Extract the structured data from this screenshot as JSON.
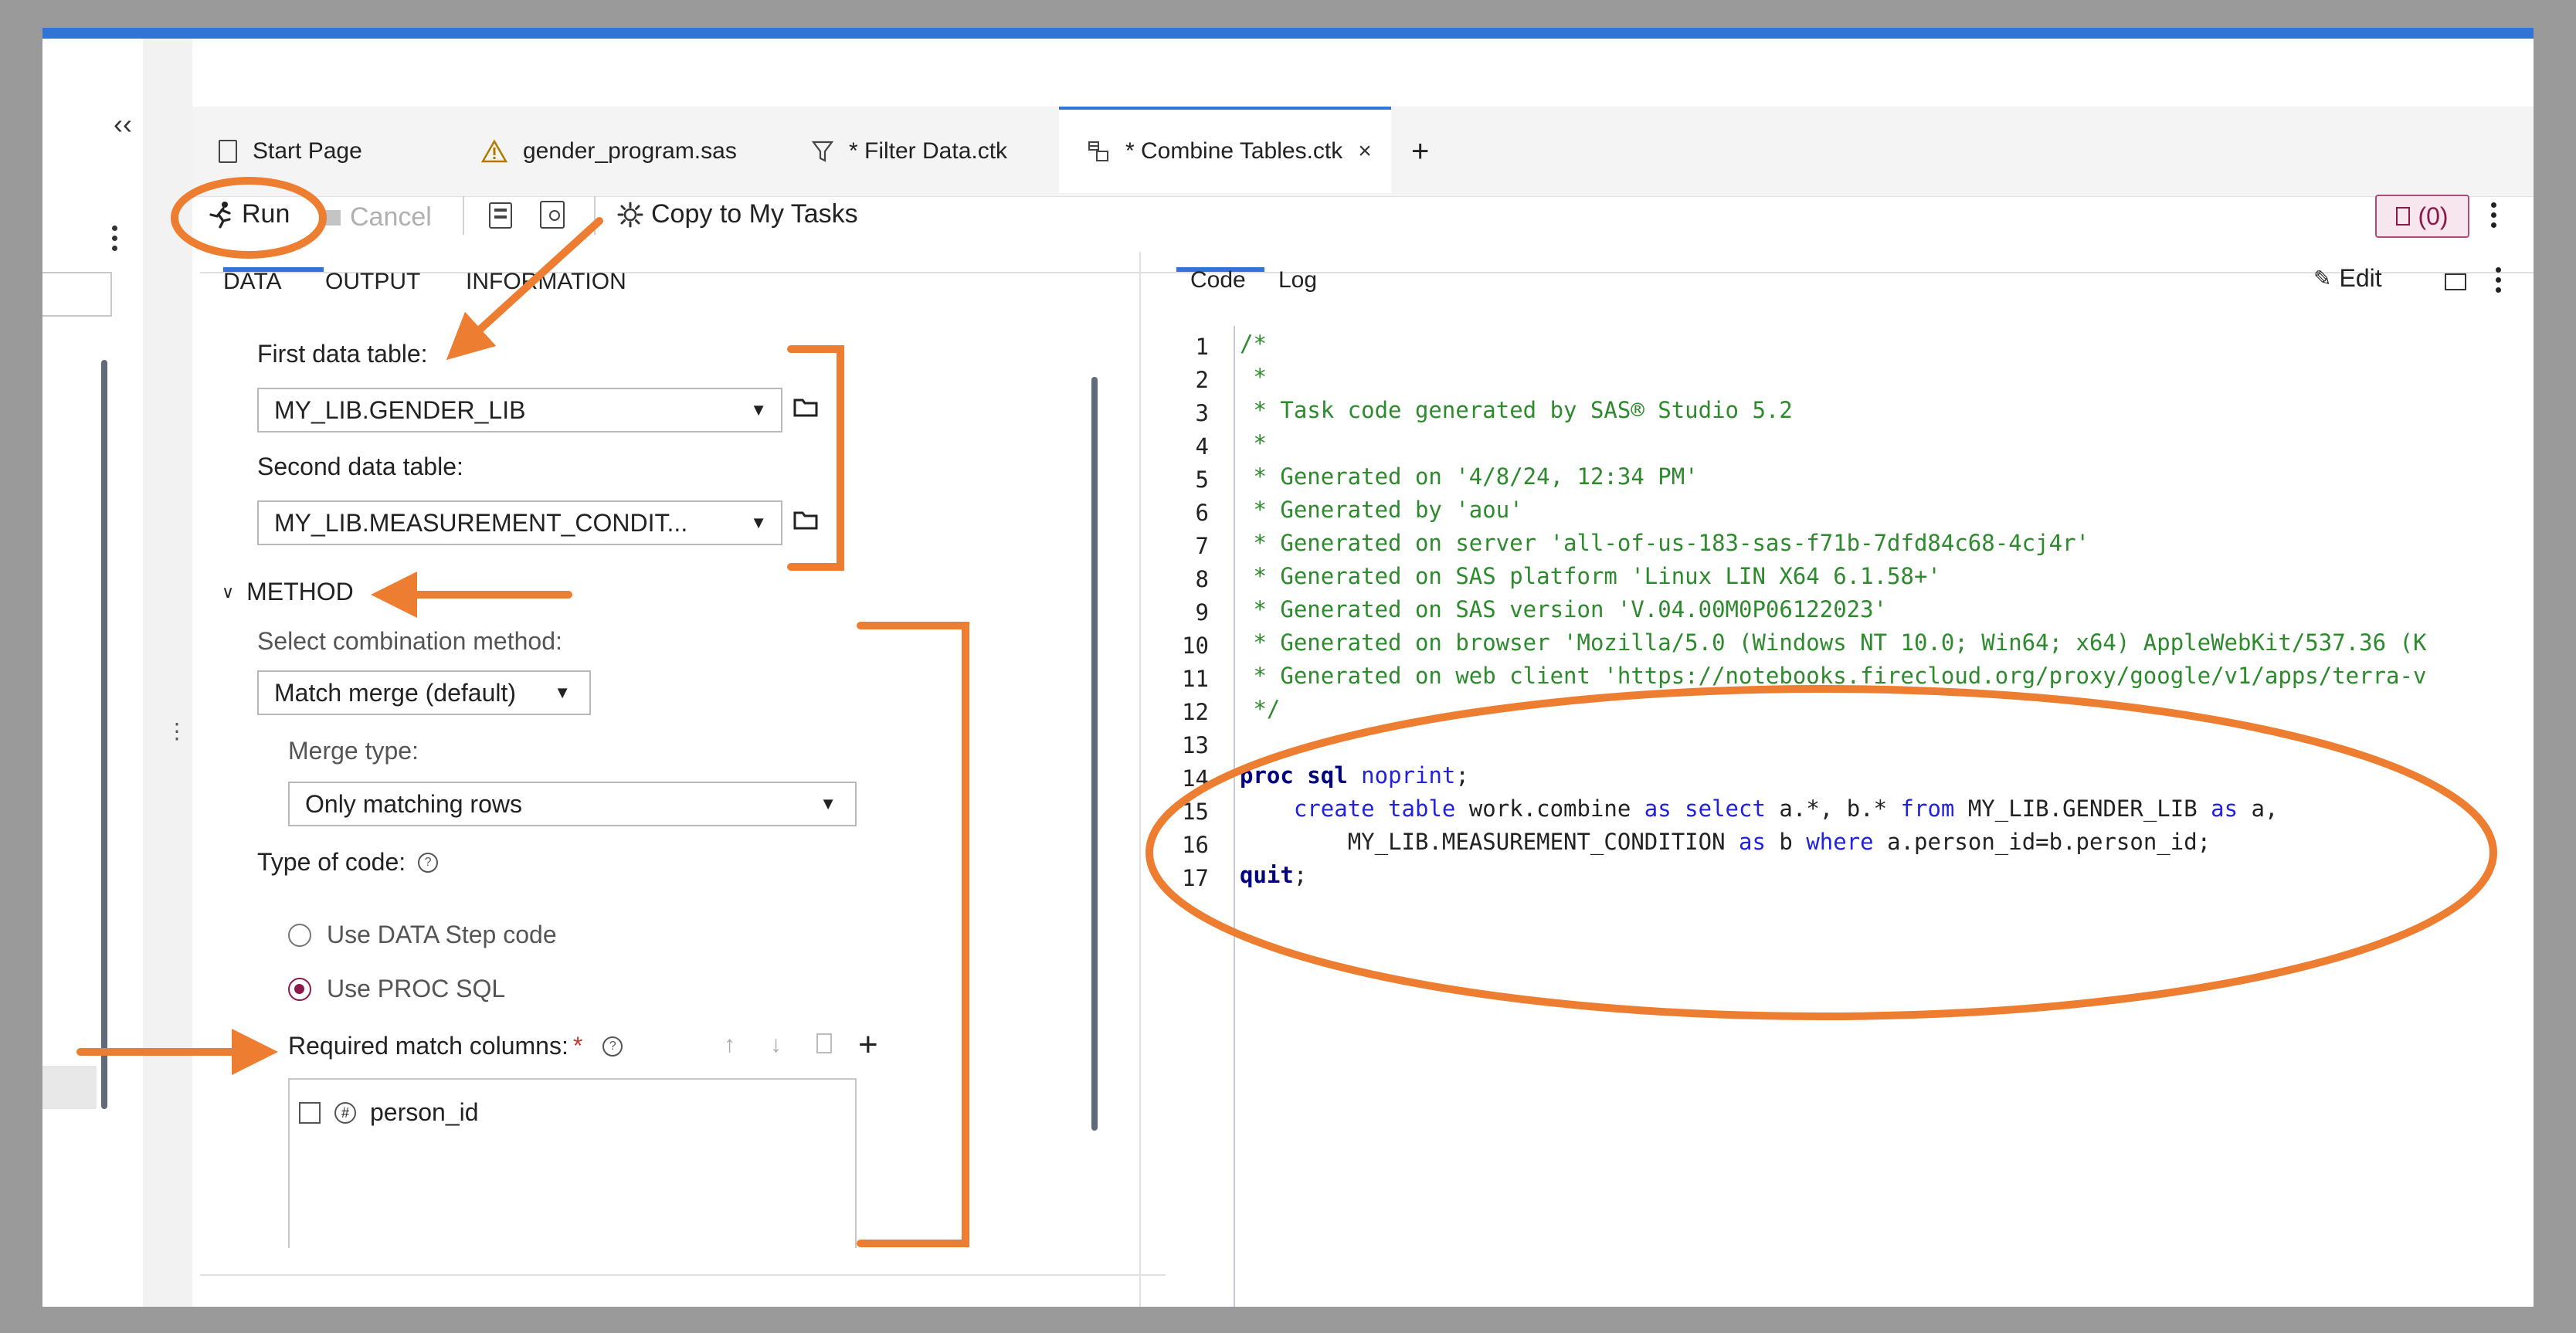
{
  "tabs": [
    {
      "label": "Start Page",
      "icon": "start-page-icon"
    },
    {
      "label": "gender_program.sas",
      "icon": "warning-icon"
    },
    {
      "label": "* Filter Data.ctk",
      "icon": "filter-icon"
    },
    {
      "label": "* Combine Tables.ctk",
      "icon": "task-icon",
      "active": true
    }
  ],
  "tab_close": "×",
  "tab_add": "+",
  "collapse": "‹‹",
  "toolbar": {
    "run": "Run",
    "cancel": "Cancel",
    "copy_to_tasks": "Copy to My Tasks",
    "submissions": "(0)"
  },
  "left_tabs": [
    "DATA",
    "OUTPUT",
    "INFORMATION"
  ],
  "data_tab": {
    "first_label": "First data table:",
    "first_value": "MY_LIB.GENDER_LIB",
    "second_label": "Second data table:",
    "second_value": "MY_LIB.MEASUREMENT_CONDIT...",
    "method_header": "METHOD",
    "combination_label": "Select combination method:",
    "combination_value": "Match merge (default)",
    "merge_type_label": "Merge type:",
    "merge_type_value": "Only matching rows",
    "code_type_label": "Type of code:",
    "radio_data_step": "Use DATA Step code",
    "radio_proc_sql": "Use PROC SQL",
    "required_label": "Required match columns:",
    "required_star": "*",
    "column_item": "person_id"
  },
  "right_tabs": [
    "Code",
    "Log"
  ],
  "edit_label": "Edit",
  "code": {
    "line_numbers": [
      "1",
      "2",
      "3",
      "4",
      "5",
      "6",
      "7",
      "8",
      "9",
      "10",
      "11",
      "12",
      "13",
      "14",
      "15",
      "16",
      "17"
    ],
    "comment_lines": [
      "/*",
      " *",
      " * Task code generated by SAS® Studio 5.2",
      " *",
      " * Generated on '4/8/24, 12:34 PM'",
      " * Generated by 'aou'",
      " * Generated on server 'all-of-us-183-sas-f71b-7dfd84c68-4cj4r'",
      " * Generated on SAS platform 'Linux LIN X64 6.1.58+'",
      " * Generated on SAS version 'V.04.00M0P06122023'",
      " * Generated on browser 'Mozilla/5.0 (Windows NT 10.0; Win64; x64) AppleWebKit/537.36 (K",
      " * Generated on web client 'https://notebooks.firecloud.org/proxy/google/v1/apps/terra-v",
      " */"
    ],
    "l14_kw": "proc sql",
    "l14_opt": " noprint",
    "l14_end": ";",
    "l15_indent": "    ",
    "l15_kw1": "create table",
    "l15_t1": " work.combine ",
    "l15_kw2": "as select",
    "l15_t2": " a.*, b.* ",
    "l15_kw3": "from",
    "l15_t3": " MY_LIB.GENDER_LIB ",
    "l15_kw4": "as",
    "l15_t4": " a,",
    "l16_indent": "        ",
    "l16_t1": "MY_LIB.MEASUREMENT_CONDITION ",
    "l16_kw1": "as",
    "l16_t2": " b ",
    "l16_kw2": "where",
    "l16_t3": " a.person_id=b.person_id;",
    "l17_kw": "quit",
    "l17_end": ";"
  },
  "colors": {
    "accent": "#2f74d6",
    "annotation": "#ed7d31",
    "comment": "#2d8a2d",
    "keyword": "#000080",
    "radio_selected": "#8b1a4a"
  }
}
